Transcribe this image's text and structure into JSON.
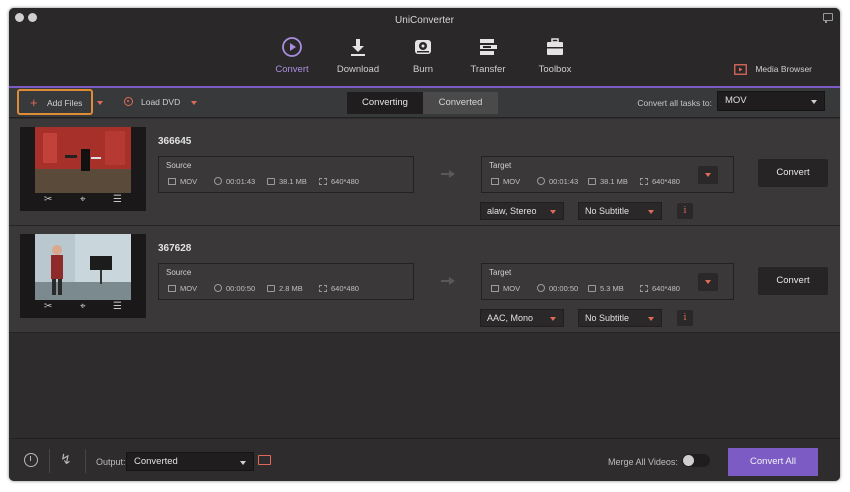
{
  "window": {
    "title": "UniConverter"
  },
  "nav": [
    {
      "label": "Convert",
      "icon": "convert-icon",
      "active": true
    },
    {
      "label": "Download",
      "icon": "download-icon"
    },
    {
      "label": "Burn",
      "icon": "burn-icon"
    },
    {
      "label": "Transfer",
      "icon": "transfer-icon"
    },
    {
      "label": "Toolbox",
      "icon": "toolbox-icon"
    }
  ],
  "media_browser": {
    "label": "Media Browser"
  },
  "toolbar": {
    "add_files": "Add Files",
    "load_dvd": "Load DVD",
    "tabs": [
      "Converting",
      "Converted"
    ],
    "convert_all_label": "Convert all tasks to:",
    "format": "MOV"
  },
  "files": [
    {
      "name": "366645",
      "source": {
        "title": "Source",
        "format": "MOV",
        "duration": "00:01:43",
        "size": "38.1 MB",
        "resolution": "640*480"
      },
      "target": {
        "title": "Target",
        "format": "MOV",
        "duration": "00:01:43",
        "size": "38.1 MB",
        "resolution": "640*480"
      },
      "audio": "alaw, Stereo",
      "subtitle": "No Subtitle",
      "convert_label": "Convert"
    },
    {
      "name": "367628",
      "source": {
        "title": "Source",
        "format": "MOV",
        "duration": "00:00:50",
        "size": "2.8 MB",
        "resolution": "640*480"
      },
      "target": {
        "title": "Target",
        "format": "MOV",
        "duration": "00:00:50",
        "size": "5.3 MB",
        "resolution": "640*480"
      },
      "audio": "AAC, Mono",
      "subtitle": "No Subtitle",
      "convert_label": "Convert"
    }
  ],
  "bottom": {
    "output_label": "Output:",
    "output_value": "Converted",
    "merge_label": "Merge All Videos:",
    "convert_all": "Convert All"
  },
  "colors": {
    "accent": "#7c5cc4",
    "highlight": "#e08b36",
    "icon_red": "#e06a5a"
  }
}
